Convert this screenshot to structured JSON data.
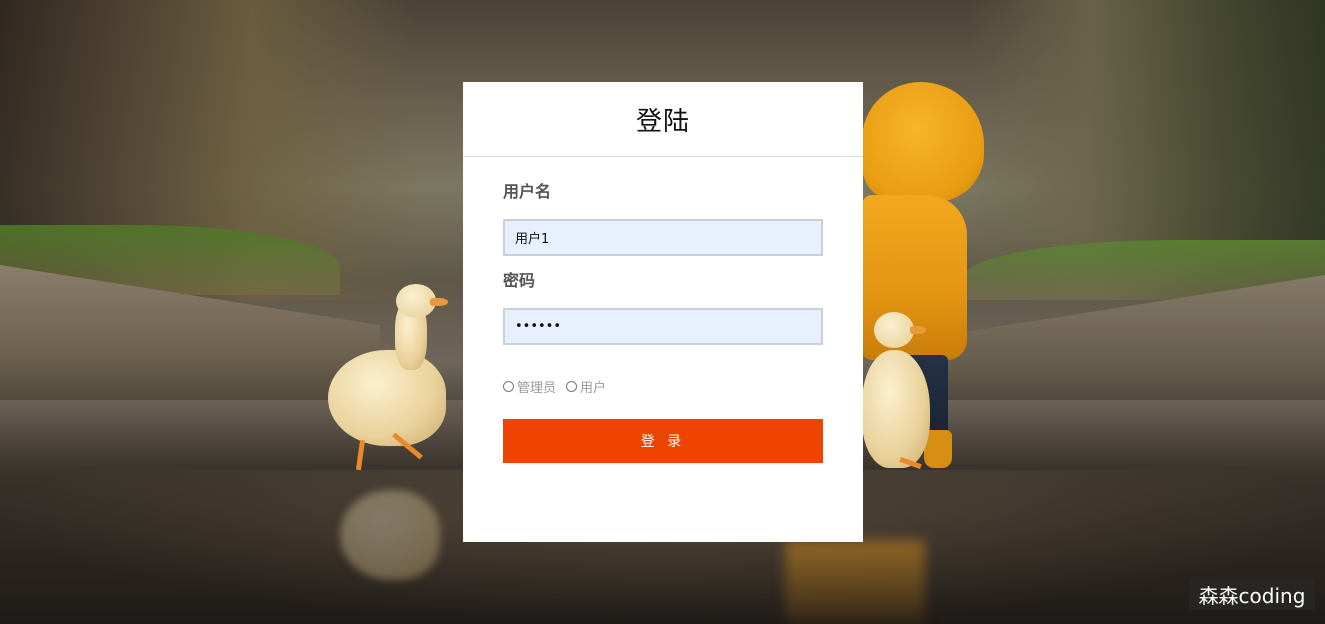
{
  "login": {
    "title": "登陆",
    "username_label": "用户名",
    "username_value": "用户1",
    "password_label": "密码",
    "password_value": "••••••",
    "roles": [
      {
        "label": "管理员",
        "checked": false
      },
      {
        "label": "用户",
        "checked": false
      }
    ],
    "submit_label": "登 录"
  },
  "watermark": {
    "text": "森森coding"
  },
  "colors": {
    "submit_button": "#ef4300",
    "input_background": "#e8f0fe",
    "card_background": "#ffffff"
  }
}
